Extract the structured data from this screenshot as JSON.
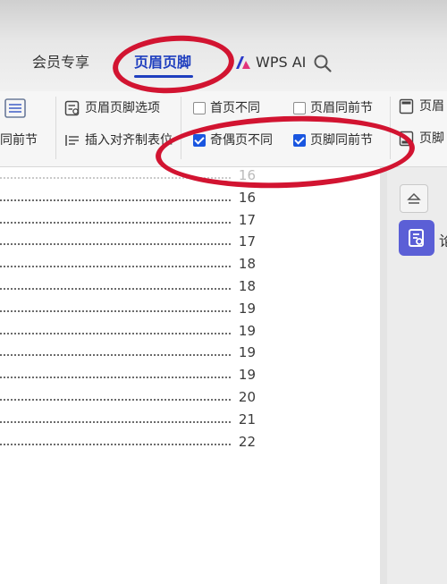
{
  "tabs": {
    "member": "会员专享",
    "header_footer": "页眉页脚",
    "wps_ai": "WPS AI"
  },
  "ribbon": {
    "same_as_prev_left": "同前节",
    "header_footer_options": "页眉页脚选项",
    "insert_align_tab": "插入对齐制表位",
    "first_page_different": {
      "label": "首页不同",
      "checked": false
    },
    "odd_even_different": {
      "label": "奇偶页不同",
      "checked": true
    },
    "header_same_as_prev": {
      "label": "页眉同前节",
      "checked": false
    },
    "footer_same_as_prev": {
      "label": "页脚同前节",
      "checked": true
    },
    "right_cut_top": "页眉",
    "right_cut_bottom": "页脚"
  },
  "toc_pages": [
    "16",
    "16",
    "17",
    "17",
    "18",
    "18",
    "19",
    "19",
    "19",
    "19",
    "20",
    "21",
    "22"
  ],
  "side_panel": {
    "label": "论"
  },
  "colors": {
    "accent": "#1f3fbf",
    "checkbox": "#1a56e0",
    "annotation": "#d21431",
    "side_tool": "#5b5fd6"
  }
}
